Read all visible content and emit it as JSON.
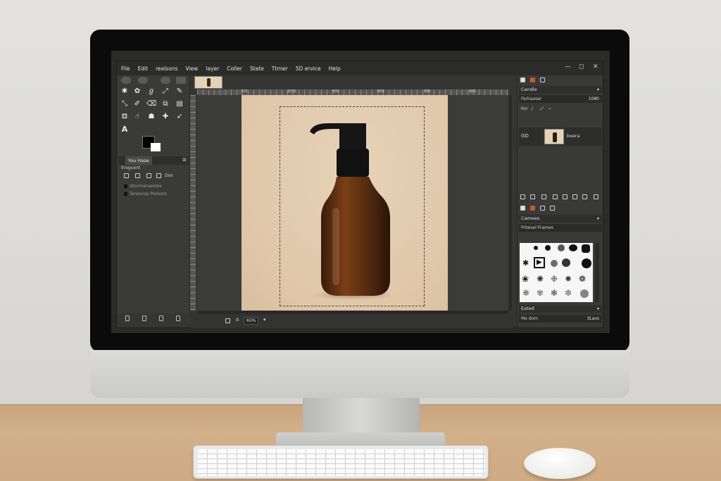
{
  "menubar": {
    "items": [
      "File",
      "Edit",
      "realsons",
      "View",
      "Iayer",
      "Coller",
      "State",
      "Ttrner",
      "5D ervice",
      "Help"
    ],
    "window_controls": [
      "—",
      "◻",
      "✕"
    ]
  },
  "toolbox": {
    "text_tool_glyph": "A",
    "dock_tab": "You Hase",
    "dock_title": "Ereguent",
    "dock_action": "Dox",
    "options": [
      "Stoirmersentes",
      "Tenoorop Prelsors"
    ]
  },
  "rulers": {
    "horizontal": [
      "175",
      "2050",
      "600",
      "800",
      "800",
      "800"
    ]
  },
  "status": {
    "zoom": "65%"
  },
  "layers_dock": {
    "panel_title": "Candle",
    "mode_label": "Farhaaser",
    "mode_value": "1080",
    "lock_label": "Kor",
    "layer_index": "GD",
    "layer_name": "bxera"
  },
  "brushes_dock": {
    "panel_title": "Camees",
    "filter_label": "Prbesel Frames",
    "footer_title": "Eated",
    "spacing_label": "Mo dom",
    "spacing_value": "3Lavs"
  },
  "colors": {
    "app_bg": "#353534",
    "canvas_image": "#e0c9aa",
    "bottle_amber": "#5a2f14",
    "pump_black": "#141414"
  },
  "icons": [
    "file-icon",
    "brush-icon",
    "eraser-icon",
    "gear-icon",
    "layers-icon",
    "anchor-icon",
    "trash-icon"
  ]
}
